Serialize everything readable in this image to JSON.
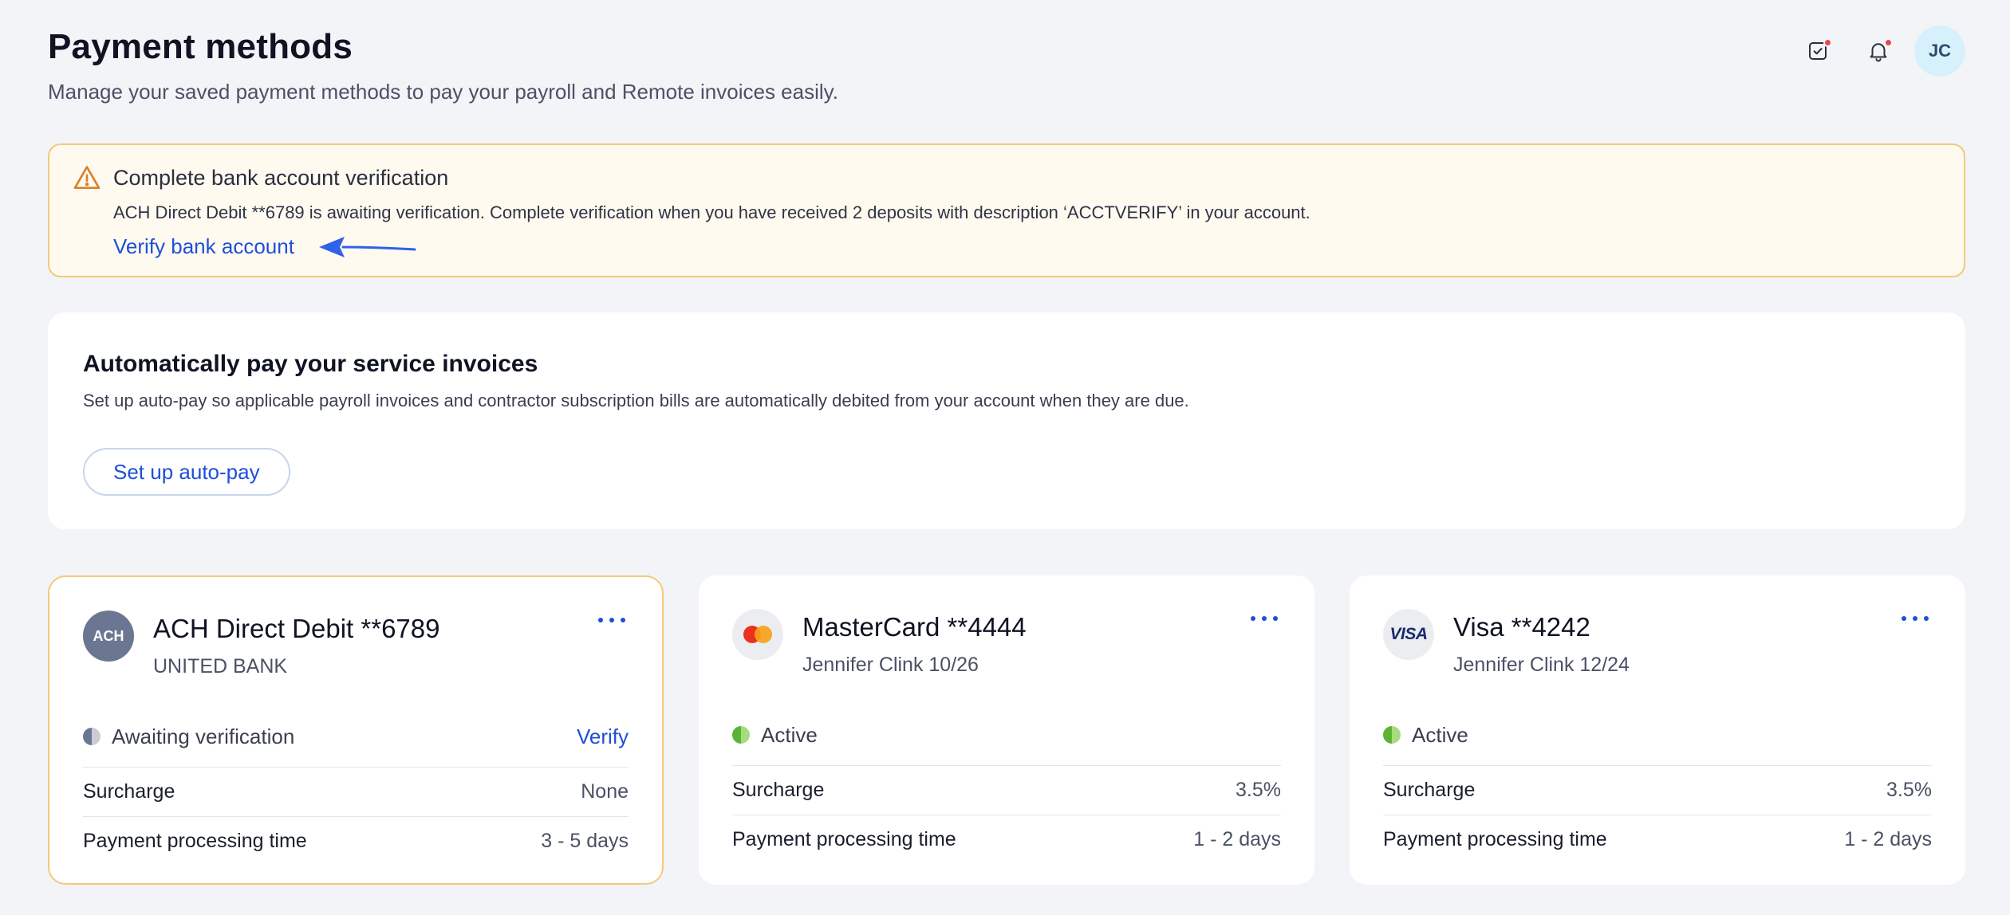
{
  "header": {
    "title": "Payment methods",
    "subtitle": "Manage your saved payment methods to pay your payroll and Remote invoices easily.",
    "avatar_initials": "JC",
    "icons": [
      "task-check-icon",
      "bell-icon"
    ]
  },
  "alert": {
    "title": "Complete bank account verification",
    "body": "ACH Direct Debit **6789 is awaiting verification. Complete verification when you have received 2 deposits with description ‘ACCTVERIFY’ in your account.",
    "link": "Verify bank account"
  },
  "autopay": {
    "title": "Automatically pay your service invoices",
    "description": "Set up auto-pay so applicable payroll invoices and contractor subscription bills are automatically debited from your account when they are due.",
    "button": "Set up auto-pay"
  },
  "cards": [
    {
      "logo_text": "ACH",
      "title": "ACH Direct Debit **6789",
      "subtitle": "UNITED BANK",
      "status": "Awaiting verification",
      "status_action": "Verify",
      "surcharge_label": "Surcharge",
      "surcharge_value": "None",
      "processing_label": "Payment processing time",
      "processing_value": "3 - 5 days"
    },
    {
      "title": "MasterCard **4444",
      "subtitle": "Jennifer Clink  10/26",
      "status": "Active",
      "surcharge_label": "Surcharge",
      "surcharge_value": "3.5%",
      "processing_label": "Payment processing time",
      "processing_value": "1 - 2 days"
    },
    {
      "logo_text": "VISA",
      "title": "Visa **4242",
      "subtitle": "Jennifer Clink  12/24",
      "status": "Active",
      "surcharge_label": "Surcharge",
      "surcharge_value": "3.5%",
      "processing_label": "Payment processing time",
      "processing_value": "1 - 2 days"
    }
  ],
  "colors": {
    "accent": "#1d4fd8",
    "warning_border": "#f3c97a",
    "warning_bg": "#fffaf0",
    "active_green": "#5ab335",
    "notification_red": "#e5484d"
  }
}
